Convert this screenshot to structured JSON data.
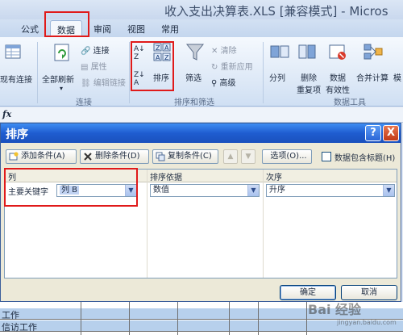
{
  "window": {
    "title": "收入支出决算表.XLS  [兼容模式] - Micros"
  },
  "tabs": [
    {
      "label": "公式"
    },
    {
      "label": "数据"
    },
    {
      "label": "审阅"
    },
    {
      "label": "视图"
    },
    {
      "label": "常用"
    }
  ],
  "ribbon": {
    "existing_conn": "现有连接",
    "refresh_all": "全部刷新",
    "connections": "连接",
    "properties": "属性",
    "edit_links": "编辑链接",
    "group_connections": "连接",
    "sort": "排序",
    "filter": "筛选",
    "clear": "清除",
    "reapply": "重新应用",
    "advanced": "高级",
    "group_sort_filter": "排序和筛选",
    "text_to_columns": "分列",
    "remove_duplicates_1": "删除",
    "remove_duplicates_2": "重复项",
    "data_validation_1": "数据",
    "data_validation_2": "有效性",
    "consolidate": "合并计算",
    "whatif": "模",
    "group_data_tools": "数据工具"
  },
  "formula_bar": {
    "fx": "fx"
  },
  "dialog": {
    "title": "排序",
    "help": "?",
    "close": "X",
    "add_level": "添加条件(A)",
    "delete_level": "删除条件(D)",
    "copy_level": "复制条件(C)",
    "move_up": "▲",
    "move_down": "▼",
    "options": "选项(O)...",
    "has_headers": "数据包含标题(H)",
    "header_column": "列",
    "header_sort_on": "排序依据",
    "header_order": "次序",
    "row": {
      "label": "主要关键字",
      "column": "列 B",
      "sort_on": "数值",
      "order": "升序"
    },
    "ok": "确定",
    "cancel": "取消"
  },
  "sheet_rows": [
    {
      "text": "工作"
    },
    {
      "text": "信访工作"
    }
  ],
  "watermark": {
    "main": "Bai 经验",
    "sub": "jingyan.baidu.com"
  },
  "colors": {
    "highlight": "#e01a1a",
    "titlebar": "#1f5dd0"
  }
}
